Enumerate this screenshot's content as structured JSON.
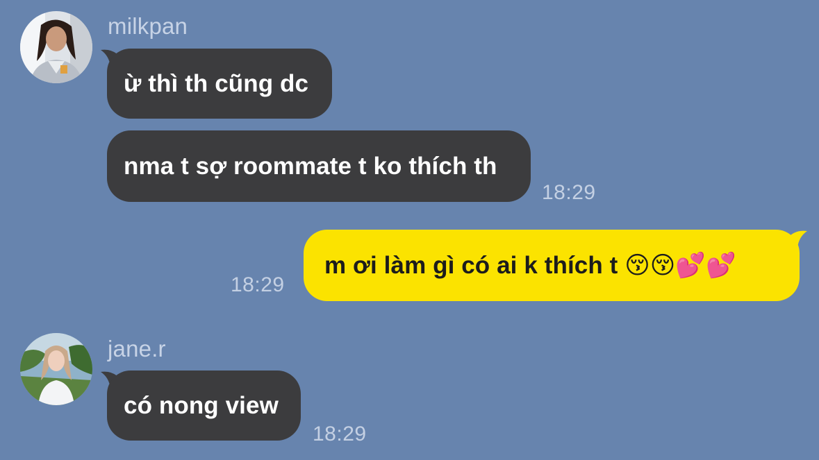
{
  "colors": {
    "background": "#6784ae",
    "incoming_bubble": "#3c3c3e",
    "outgoing_bubble": "#fbe300",
    "name_text": "#c7d3e6",
    "timestamp_text": "#c4d0e3"
  },
  "messages": [
    {
      "sender": "milkpan",
      "avatar_icon": "user-photo-avatar",
      "bubbles": [
        {
          "text": "ừ thì th cũng dc"
        },
        {
          "text": "nma t sợ roommate t ko thích th",
          "time": "18:29"
        }
      ]
    },
    {
      "sender": "me",
      "bubbles": [
        {
          "text": "m ơi làm gì có ai k thích t 😚😚💕💕",
          "time": "18:29"
        }
      ]
    },
    {
      "sender": "jane.r",
      "avatar_icon": "user-photo-avatar",
      "bubbles": [
        {
          "text": "có nong view",
          "time": "18:29"
        }
      ]
    }
  ]
}
